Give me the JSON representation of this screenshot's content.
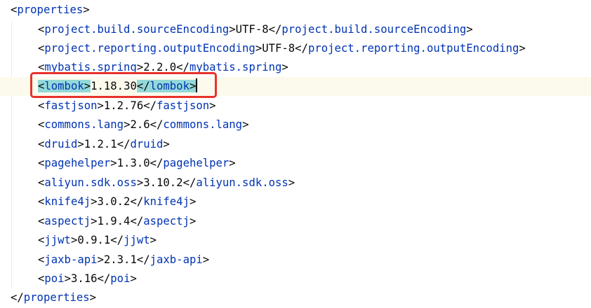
{
  "editor": {
    "accent_colors": {
      "tag": "#0033b3",
      "text": "#080808",
      "match_highlight": "#93d9d9",
      "current_line": "#fcfaed",
      "annotation_box": "#e8322a"
    },
    "root_tag": "properties",
    "lines": [
      {
        "tag": "project.build.sourceEncoding",
        "value": "UTF-8"
      },
      {
        "tag": "project.reporting.outputEncoding",
        "value": "UTF-8"
      },
      {
        "tag": "mybatis.spring",
        "value": "2.2.0"
      },
      {
        "tag": "lombok",
        "value": "1.18.30"
      },
      {
        "tag": "fastjson",
        "value": "1.2.76"
      },
      {
        "tag": "commons.lang",
        "value": "2.6"
      },
      {
        "tag": "druid",
        "value": "1.2.1"
      },
      {
        "tag": "pagehelper",
        "value": "1.3.0"
      },
      {
        "tag": "aliyun.sdk.oss",
        "value": "3.10.2"
      },
      {
        "tag": "knife4j",
        "value": "3.0.2"
      },
      {
        "tag": "aspectj",
        "value": "1.9.4"
      },
      {
        "tag": "jjwt",
        "value": "0.9.1"
      },
      {
        "tag": "jaxb-api",
        "value": "2.3.1"
      },
      {
        "tag": "poi",
        "value": "3.16"
      }
    ]
  }
}
